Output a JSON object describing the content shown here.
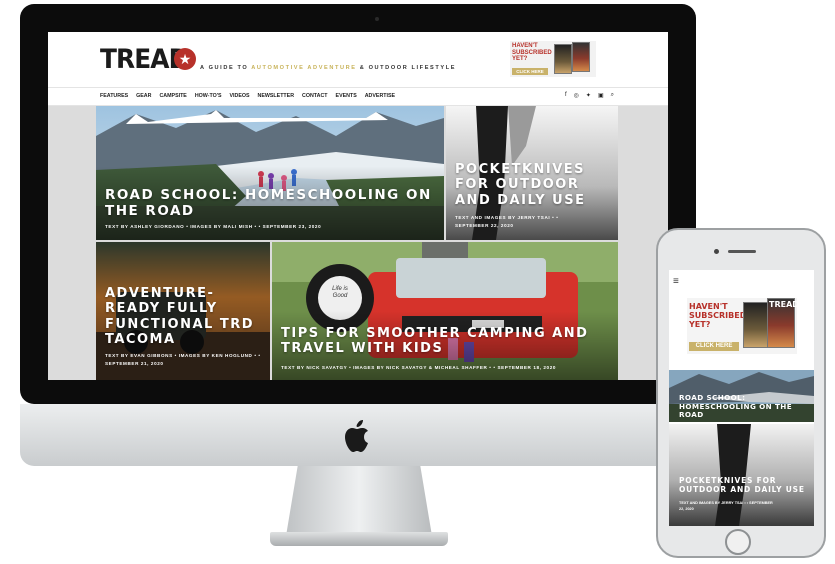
{
  "site": {
    "logo": "TREAD",
    "tagline_pre": "A GUIDE TO ",
    "tagline_accent": "AUTOMOTIVE ADVENTURE",
    "tagline_post": " & OUTDOOR LIFESTYLE"
  },
  "promo": {
    "text": "HAVEN'T SUBSCRIBED YET?",
    "button": "CLICK HERE"
  },
  "nav": [
    "FEATURES",
    "GEAR",
    "CAMPSITE",
    "HOW-TO'S",
    "VIDEOS",
    "NEWSLETTER",
    "CONTACT",
    "EVENTS",
    "ADVERTISE"
  ],
  "social": [
    "f",
    "◎",
    "✦",
    "▣",
    "⌕"
  ],
  "articles": [
    {
      "title": "ROAD SCHOOL: HOMESCHOOLING ON THE ROAD",
      "meta": "TEXT BY ASHLEY GIORDANO • IMAGES BY MALI MISH • • SEPTEMBER 23, 2020"
    },
    {
      "title": "POCKETKNIVES FOR OUTDOOR AND DAILY USE",
      "meta": "TEXT AND IMAGES BY JERRY TSAI • • SEPTEMBER 22, 2020"
    },
    {
      "title": "ADVENTURE-READY FULLY FUNCTIONAL TRD TACOMA",
      "meta": "TEXT BY EVAN GIBBONS • IMAGES BY KEN HOGLUND • • SEPTEMBER 21, 2020"
    },
    {
      "title": "TIPS FOR SMOOTHER CAMPING AND TRAVEL WITH KIDS",
      "meta": "TEXT BY NICK SAVATGY • IMAGES BY NICK SAVATGY & MICHEAL SHAFFER • • SEPTEMBER 18, 2020"
    }
  ],
  "spare_tire": "Life is Good",
  "mobile": {
    "menu_icon": "≡",
    "promo_text": "HAVEN'T SUBSCRIBED YET?",
    "promo_button": "CLICK HERE",
    "mag_logo": "TREAD",
    "article1_title": "ROAD SCHOOL: HOMESCHOOLING ON THE ROAD",
    "article2_title": "POCKETKNIVES FOR OUTDOOR AND DAILY USE",
    "article2_meta": "TEXT AND IMAGES BY JERRY TSAI • • SEPTEMBER 22, 2020"
  },
  "colors": {
    "brand_red": "#b7312a",
    "accent_gold": "#c8b35a",
    "bezel": "#0c0c0c"
  }
}
